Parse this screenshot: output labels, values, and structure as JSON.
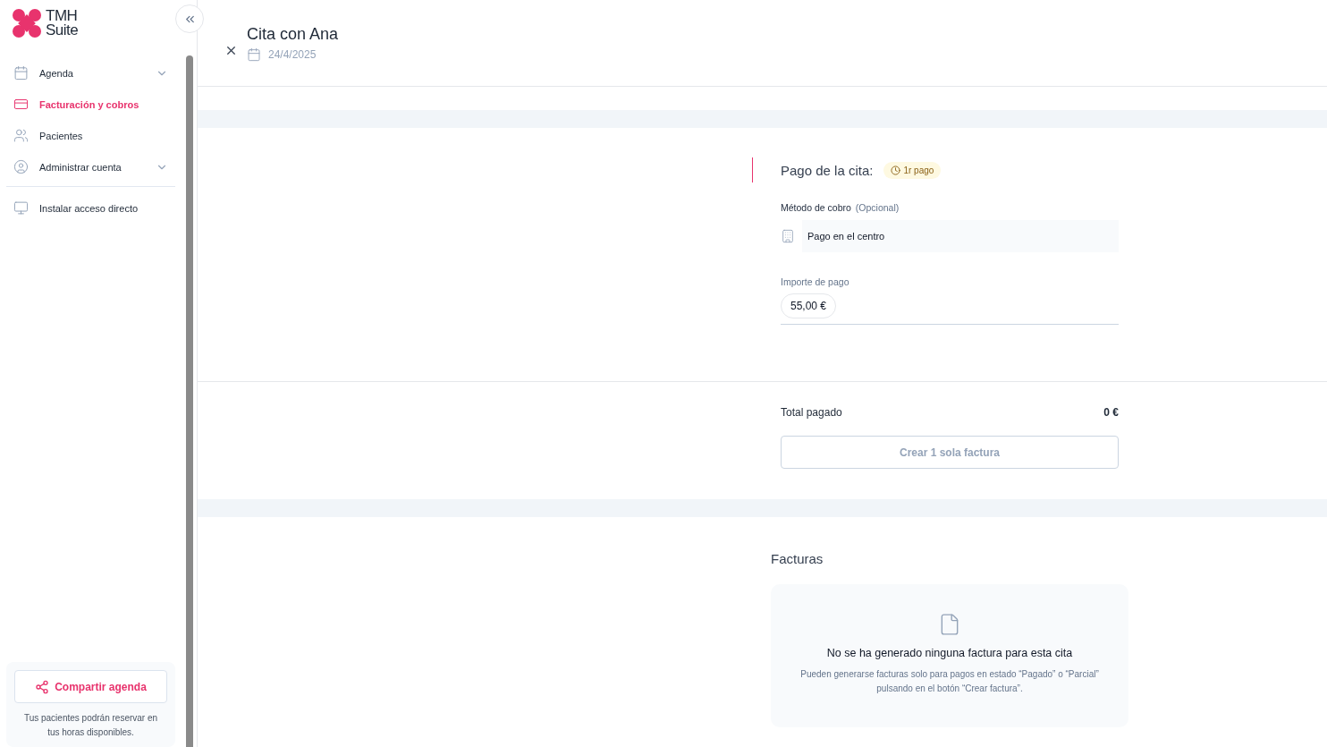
{
  "brand": {
    "line1": "TMH",
    "line2": "Suite"
  },
  "sidebar": {
    "items": [
      {
        "label": "Agenda",
        "selected": false,
        "expandable": true
      },
      {
        "label": "Facturación y cobros",
        "selected": true,
        "expandable": false
      },
      {
        "label": "Pacientes",
        "selected": false,
        "expandable": false
      },
      {
        "label": "Administrar cuenta",
        "selected": false,
        "expandable": true
      }
    ],
    "tools": [
      {
        "label": "Instalar acceso directo",
        "selected": false,
        "expandable": false
      }
    ],
    "share": {
      "button": "Compartir agenda",
      "note": "Tus pacientes podrán reservar en tus horas disponibles."
    }
  },
  "header": {
    "title": "Cita con Ana",
    "date": "24/4/2025"
  },
  "payment": {
    "title": "Pago de la cita:",
    "badge": "1r pago",
    "method_label": "Método de cobro",
    "method_optional": "(Opcional)",
    "method_value": "Pago en el centro",
    "amount_label": "Importe de pago",
    "amount_value": "55,00 €"
  },
  "summary": {
    "total_label": "Total pagado",
    "total_value": "0 €",
    "button": "Crear 1 sola factura",
    "button_disabled": true
  },
  "invoices": {
    "title": "Facturas",
    "empty_title": "No se ha generado ninguna factura para esta cita",
    "empty_text": "Pueden generarse facturas solo para pagos en estado “Pagado” o “Parcial” pulsando en el botón “Crear factura”."
  }
}
